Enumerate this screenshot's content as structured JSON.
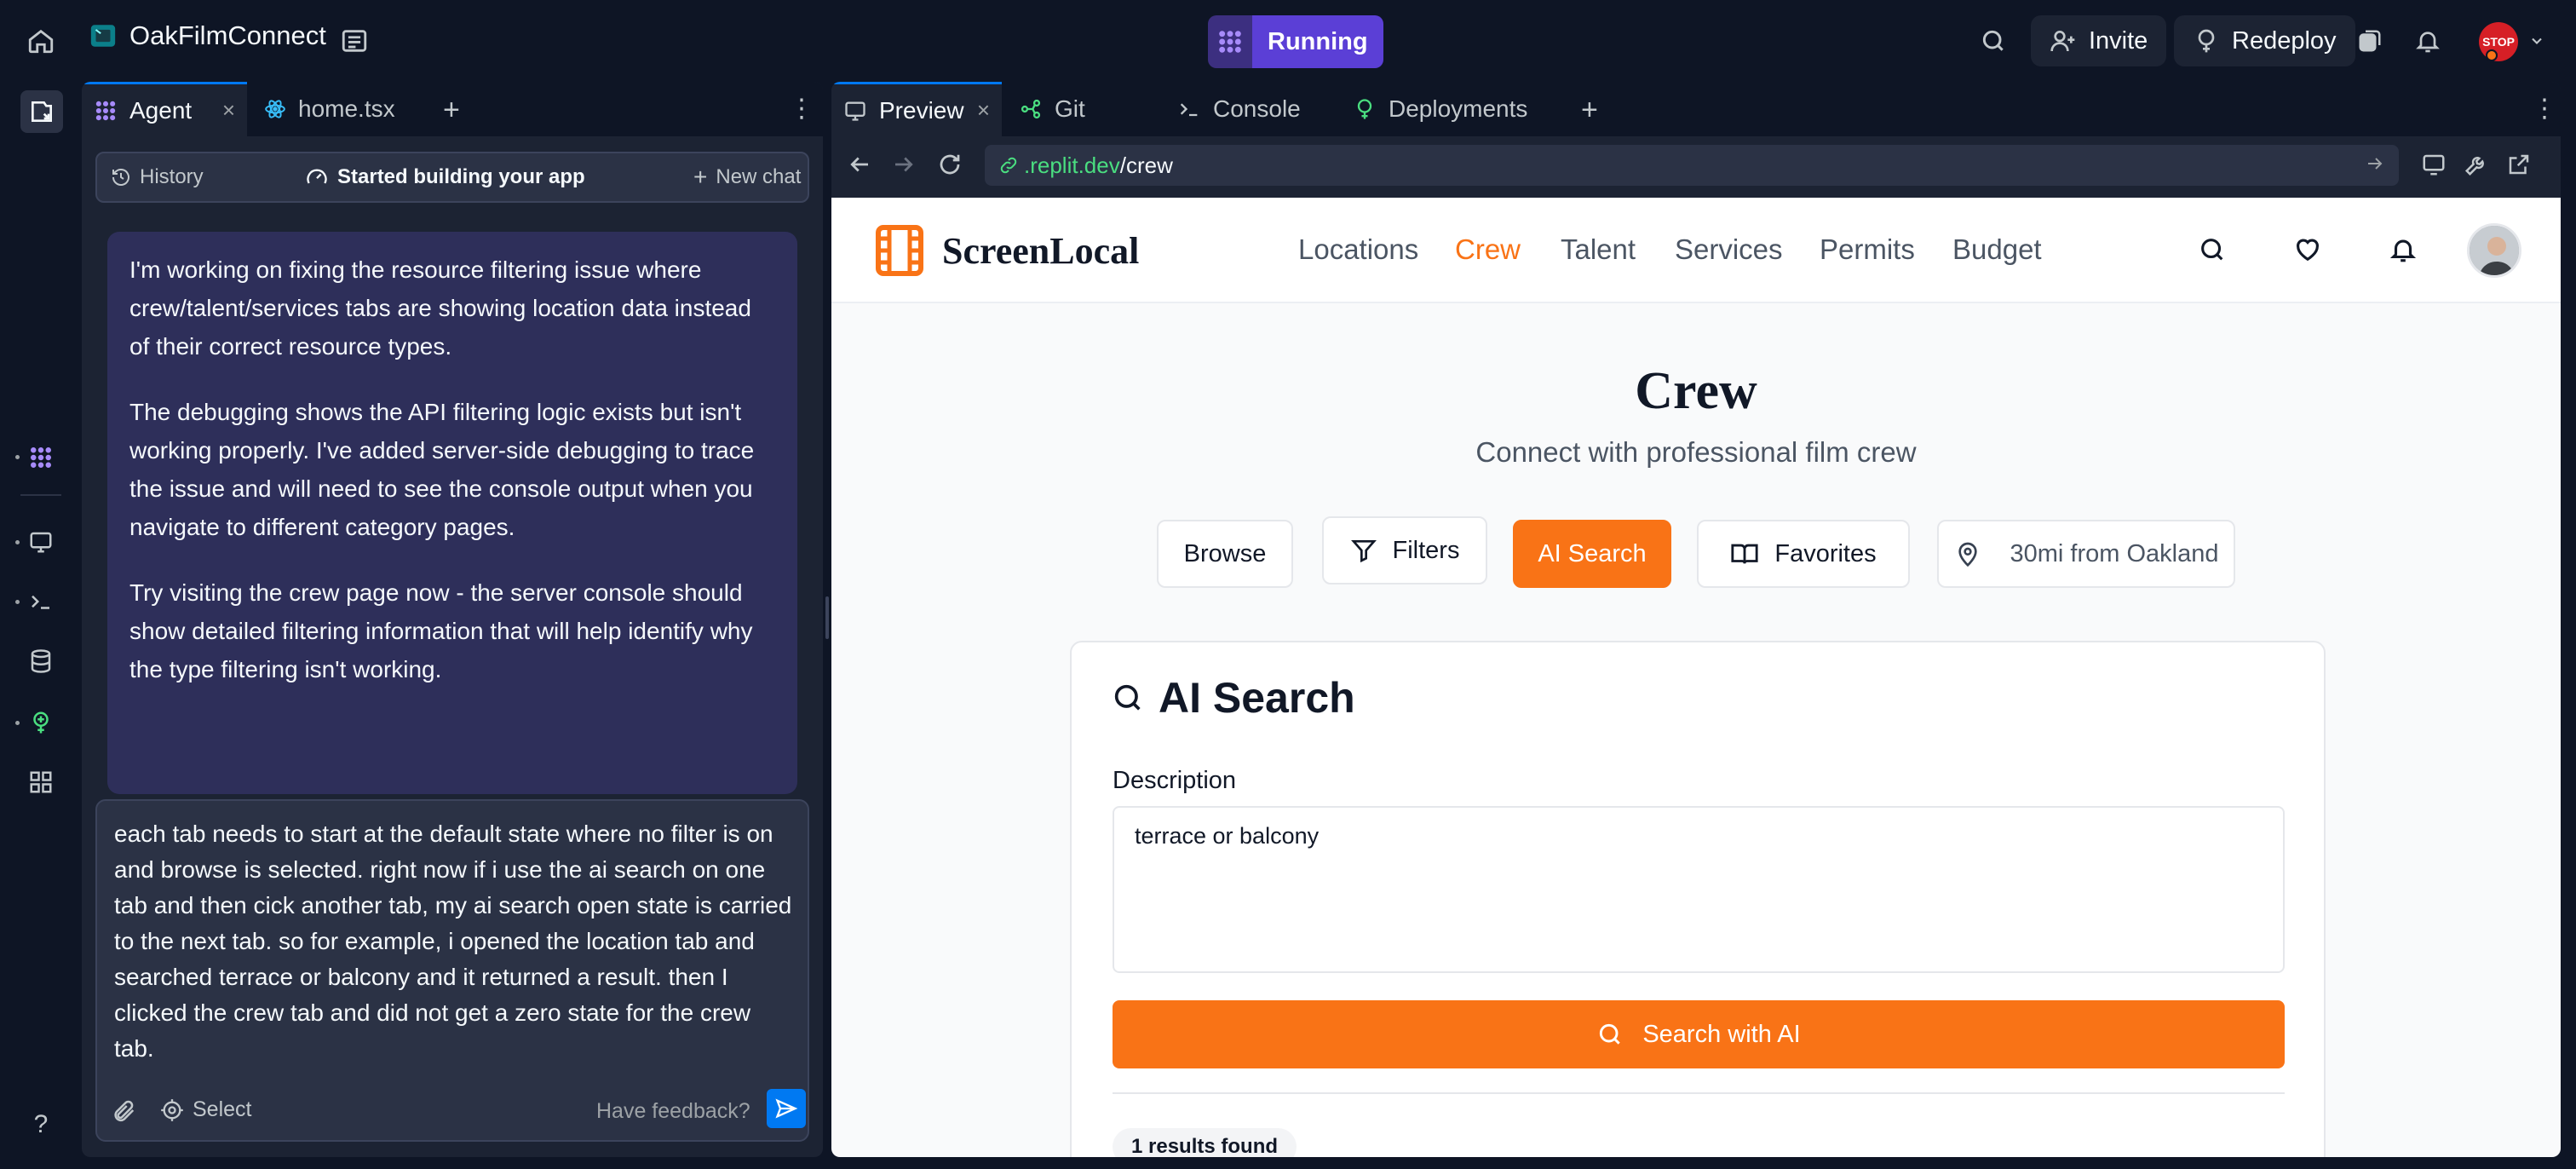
{
  "topbar": {
    "project_name": "OakFilmConnect",
    "status_label": "Running",
    "invite_label": "Invite",
    "redeploy_label": "Redeploy",
    "avatar_badge": "STOP"
  },
  "agent_panel": {
    "tabs": [
      {
        "label": "Agent"
      },
      {
        "label": "home.tsx"
      }
    ],
    "header": {
      "history_label": "History",
      "status_label": "Started building your app",
      "new_chat_label": "New chat"
    },
    "message": {
      "paragraphs": [
        "I'm working on fixing the resource filtering issue where crew/talent/services tabs are showing location data instead of their correct resource types.",
        "The debugging shows the API filtering logic exists but isn't working properly. I've added server-side debugging to trace the issue and will need to see the console output when you navigate to different category pages.",
        "Try visiting the crew page now - the server console should show detailed filtering information that will help identify why the type filtering isn't working."
      ]
    },
    "composer": {
      "text": "each tab needs to start at the default state where no filter is on and browse is selected. right now if i use the ai search on one tab and then cick another tab, my ai search open state is carried to the next tab. so for example, i opened the location tab and searched terrace or balcony and it returned a result. then I clicked the crew tab and did not get a zero state for the crew tab.",
      "select_label": "Select",
      "feedback_label": "Have feedback?"
    }
  },
  "preview_panel": {
    "tabs": [
      {
        "label": "Preview"
      },
      {
        "label": "Git"
      },
      {
        "label": "Console"
      },
      {
        "label": "Deployments"
      }
    ],
    "url_domain": ".replit.dev",
    "url_path": "/crew"
  },
  "site": {
    "brand": "ScreenLocal",
    "nav": [
      "Locations",
      "Crew",
      "Talent",
      "Services",
      "Permits",
      "Budget"
    ],
    "active_nav": "Crew",
    "page_title": "Crew",
    "page_subtitle": "Connect with professional film crew",
    "actions": {
      "browse": "Browse",
      "filters": "Filters",
      "ai_search": "AI Search",
      "favorites": "Favorites",
      "location": "30mi from Oakland"
    },
    "ai_card": {
      "title": "AI Search",
      "description_label": "Description",
      "description_value": "terrace or balcony",
      "search_button": "Search with AI",
      "results_label": "1 results found"
    },
    "colors": {
      "accent": "#f97316",
      "ide_bg": "#0e1525",
      "panel_bg": "#1c2333",
      "message_bg": "#2e2f5a"
    }
  },
  "icons": {
    "rail": [
      "home-icon",
      "file-tree-icon",
      "agent-icon",
      "preview-icon",
      "console-icon",
      "database-icon",
      "deploy-icon",
      "apps-icon",
      "help-icon"
    ],
    "topbar": [
      "search-icon",
      "user-plus-icon",
      "redeploy-icon",
      "theme-icon",
      "bell-icon"
    ]
  }
}
